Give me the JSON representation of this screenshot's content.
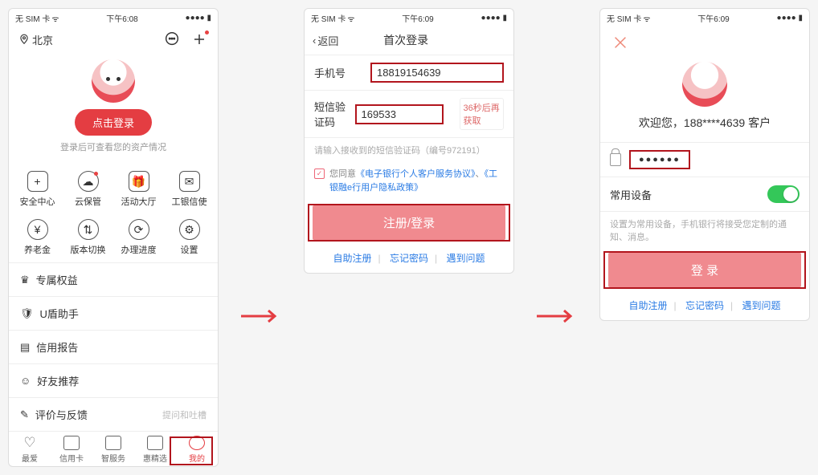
{
  "status": {
    "left": "无 SIM 卡",
    "wifi": "ᯤ",
    "time1": "下午6:08",
    "time2": "下午6:09",
    "batt": "■"
  },
  "s1": {
    "location": "北京",
    "login_button": "点击登录",
    "login_hint": "登录后可查看您的资产情况",
    "grid": [
      "安全中心",
      "云保管",
      "活动大厅",
      "工银信使",
      "养老金",
      "版本切换",
      "办理进度",
      "设置"
    ],
    "list": [
      {
        "icon": "badge",
        "label": "专属权益"
      },
      {
        "icon": "shield",
        "label": "U盾助手"
      },
      {
        "icon": "doc",
        "label": "信用报告"
      },
      {
        "icon": "people",
        "label": "好友推荐"
      },
      {
        "icon": "chat",
        "label": "评价与反馈",
        "meta": "提问和吐槽"
      }
    ],
    "tabs": [
      "最爱",
      "信用卡",
      "智服务",
      "惠精选",
      "我的"
    ]
  },
  "s2": {
    "back": "返回",
    "title": "首次登录",
    "phone_label": "手机号",
    "phone_value": "18819154639",
    "code_label": "短信验证码",
    "code_value": "169533",
    "resend": "36秒后再获取",
    "hint": "请输入接收到的短信验证码（编号972191）",
    "agree_pre": "您同意",
    "agree_link1": "《电子银行个人客户服务协议》",
    "agree_mid": "、",
    "agree_link2": "《工银融e行用户隐私政策》",
    "submit": "注册/登录",
    "links": [
      "自助注册",
      "忘记密码",
      "遇到问题"
    ]
  },
  "s3": {
    "welcome": "欢迎您，188****4639 客户",
    "password_mask": "●●●●●●",
    "device_label": "常用设备",
    "device_hint": "设置为常用设备，手机银行将接受您定制的通知、消息。",
    "submit": "登 录",
    "links": [
      "自助注册",
      "忘记密码",
      "遇到问题"
    ]
  }
}
